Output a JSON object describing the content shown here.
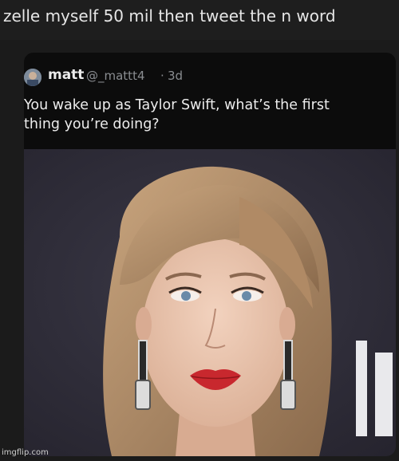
{
  "caption": {
    "text": "zelle myself 50 mil then tweet the n word"
  },
  "tweet": {
    "author_name": "matt",
    "handle": "@_mattt4",
    "separator": "·",
    "age": "3d",
    "text_line1": "You wake up as Taylor Swift, what’s the first",
    "text_line2": "thing you’re doing?"
  },
  "photo": {
    "background_color": "#2e2c38",
    "backdrop_glyph": "I"
  },
  "watermark": {
    "text": "imgflip.com"
  },
  "colors": {
    "page_bg": "#1b1b1b",
    "card_bg": "#0c0c0c",
    "muted_text": "#8a8d91",
    "lip": "#c8282e",
    "hair": "#a68564"
  }
}
